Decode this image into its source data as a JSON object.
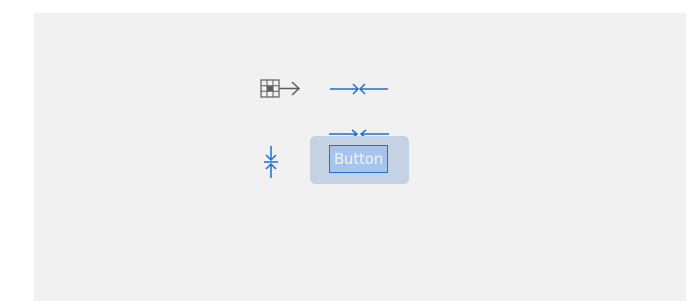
{
  "canvas": {
    "background": "#f1f1f1"
  },
  "icons": {
    "grid_arrow": "grid-to-right-arrow-icon",
    "horizontal_arrows": "horizontal-converge-arrows-icon",
    "vertical_arrows": "vertical-converge-arrows-icon",
    "button_top_arrows": "horizontal-converge-arrows-icon"
  },
  "button": {
    "label": "Button",
    "fill": "#c4d2e3",
    "selection_fill": "#a9c4ea",
    "accent": "#1f6fd1"
  }
}
